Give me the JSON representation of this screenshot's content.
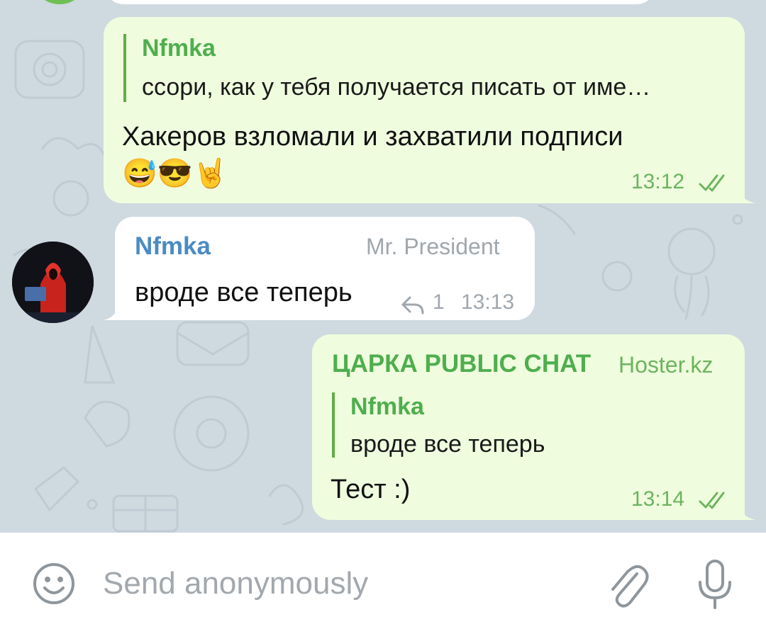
{
  "messages": {
    "m1": {
      "reply_name": "Nfmka",
      "reply_text": "ссори, как у тебя получается писать от име…",
      "text": "Хакеров взломали и захватили подписи",
      "emoji": "😅😎🤘",
      "time": "13:12"
    },
    "m2": {
      "sender": "Nfmka",
      "admin_title": "Mr. President",
      "text": "вроде все теперь",
      "reply_count": "1",
      "time": "13:13"
    },
    "m3": {
      "sender": "ЦАРКА PUBLIC CHAT",
      "admin_title": "Hoster.kz",
      "reply_name": "Nfmka",
      "reply_text": "вроде все теперь",
      "text": "Тест :)",
      "time": "13:14"
    }
  },
  "input": {
    "placeholder": "Send anonymously"
  },
  "colors": {
    "outgoing_bubble": "#effdde",
    "incoming_bubble": "#ffffff",
    "accent_green": "#4fae4e",
    "incoming_name": "#4a8bc2",
    "chat_background": "#cfd9e0"
  },
  "icons": [
    "emoji-icon",
    "attach-icon",
    "microphone-icon",
    "double-check-icon",
    "reply-arrow-icon"
  ]
}
